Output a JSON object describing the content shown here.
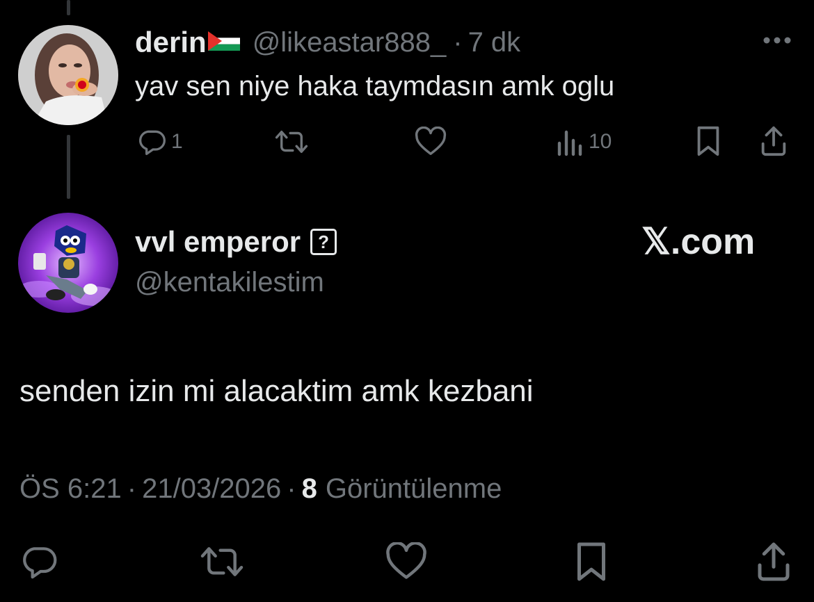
{
  "reply_tweet": {
    "display_name": "derin",
    "handle": "@likeastar888_",
    "separator": "·",
    "time_ago": "7 dk",
    "text": "yav sen niye haka taymdasın amk oglu",
    "reply_count": "1",
    "view_count": "10"
  },
  "main_tweet": {
    "display_name": "vvl emperor",
    "badge_label": "?",
    "handle": "@kentakilestim",
    "text": "senden izin mi alacaktim amk kezbani",
    "time": "ÖS 6:21",
    "date": "21/03/2026",
    "views_count": "8",
    "views_label": "Görüntülenme",
    "separator": "·"
  },
  "watermark": {
    "label": "𝕏.com"
  },
  "colors": {
    "background": "#000000",
    "text_primary": "#e7e9ea",
    "text_muted": "#71767b",
    "thread_line": "#333639",
    "flag_green": "#149954",
    "flag_red": "#e4312b"
  },
  "icons": [
    "more-icon",
    "reply-icon",
    "retweet-icon",
    "like-icon",
    "views-icon",
    "bookmark-icon",
    "share-icon",
    "palestine-flag-icon"
  ]
}
